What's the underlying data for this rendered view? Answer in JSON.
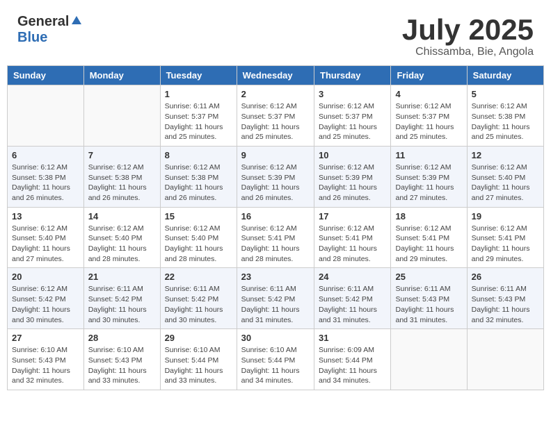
{
  "header": {
    "logo_general": "General",
    "logo_blue": "Blue",
    "title": "July 2025",
    "location": "Chissamba, Bie, Angola"
  },
  "weekdays": [
    "Sunday",
    "Monday",
    "Tuesday",
    "Wednesday",
    "Thursday",
    "Friday",
    "Saturday"
  ],
  "weeks": [
    [
      {
        "day": "",
        "empty": true
      },
      {
        "day": "",
        "empty": true
      },
      {
        "day": "1",
        "sunrise": "6:11 AM",
        "sunset": "5:37 PM",
        "daylight": "11 hours and 25 minutes."
      },
      {
        "day": "2",
        "sunrise": "6:12 AM",
        "sunset": "5:37 PM",
        "daylight": "11 hours and 25 minutes."
      },
      {
        "day": "3",
        "sunrise": "6:12 AM",
        "sunset": "5:37 PM",
        "daylight": "11 hours and 25 minutes."
      },
      {
        "day": "4",
        "sunrise": "6:12 AM",
        "sunset": "5:37 PM",
        "daylight": "11 hours and 25 minutes."
      },
      {
        "day": "5",
        "sunrise": "6:12 AM",
        "sunset": "5:38 PM",
        "daylight": "11 hours and 25 minutes."
      }
    ],
    [
      {
        "day": "6",
        "sunrise": "6:12 AM",
        "sunset": "5:38 PM",
        "daylight": "11 hours and 26 minutes."
      },
      {
        "day": "7",
        "sunrise": "6:12 AM",
        "sunset": "5:38 PM",
        "daylight": "11 hours and 26 minutes."
      },
      {
        "day": "8",
        "sunrise": "6:12 AM",
        "sunset": "5:38 PM",
        "daylight": "11 hours and 26 minutes."
      },
      {
        "day": "9",
        "sunrise": "6:12 AM",
        "sunset": "5:39 PM",
        "daylight": "11 hours and 26 minutes."
      },
      {
        "day": "10",
        "sunrise": "6:12 AM",
        "sunset": "5:39 PM",
        "daylight": "11 hours and 26 minutes."
      },
      {
        "day": "11",
        "sunrise": "6:12 AM",
        "sunset": "5:39 PM",
        "daylight": "11 hours and 27 minutes."
      },
      {
        "day": "12",
        "sunrise": "6:12 AM",
        "sunset": "5:40 PM",
        "daylight": "11 hours and 27 minutes."
      }
    ],
    [
      {
        "day": "13",
        "sunrise": "6:12 AM",
        "sunset": "5:40 PM",
        "daylight": "11 hours and 27 minutes."
      },
      {
        "day": "14",
        "sunrise": "6:12 AM",
        "sunset": "5:40 PM",
        "daylight": "11 hours and 28 minutes."
      },
      {
        "day": "15",
        "sunrise": "6:12 AM",
        "sunset": "5:40 PM",
        "daylight": "11 hours and 28 minutes."
      },
      {
        "day": "16",
        "sunrise": "6:12 AM",
        "sunset": "5:41 PM",
        "daylight": "11 hours and 28 minutes."
      },
      {
        "day": "17",
        "sunrise": "6:12 AM",
        "sunset": "5:41 PM",
        "daylight": "11 hours and 28 minutes."
      },
      {
        "day": "18",
        "sunrise": "6:12 AM",
        "sunset": "5:41 PM",
        "daylight": "11 hours and 29 minutes."
      },
      {
        "day": "19",
        "sunrise": "6:12 AM",
        "sunset": "5:41 PM",
        "daylight": "11 hours and 29 minutes."
      }
    ],
    [
      {
        "day": "20",
        "sunrise": "6:12 AM",
        "sunset": "5:42 PM",
        "daylight": "11 hours and 30 minutes."
      },
      {
        "day": "21",
        "sunrise": "6:11 AM",
        "sunset": "5:42 PM",
        "daylight": "11 hours and 30 minutes."
      },
      {
        "day": "22",
        "sunrise": "6:11 AM",
        "sunset": "5:42 PM",
        "daylight": "11 hours and 30 minutes."
      },
      {
        "day": "23",
        "sunrise": "6:11 AM",
        "sunset": "5:42 PM",
        "daylight": "11 hours and 31 minutes."
      },
      {
        "day": "24",
        "sunrise": "6:11 AM",
        "sunset": "5:42 PM",
        "daylight": "11 hours and 31 minutes."
      },
      {
        "day": "25",
        "sunrise": "6:11 AM",
        "sunset": "5:43 PM",
        "daylight": "11 hours and 31 minutes."
      },
      {
        "day": "26",
        "sunrise": "6:11 AM",
        "sunset": "5:43 PM",
        "daylight": "11 hours and 32 minutes."
      }
    ],
    [
      {
        "day": "27",
        "sunrise": "6:10 AM",
        "sunset": "5:43 PM",
        "daylight": "11 hours and 32 minutes."
      },
      {
        "day": "28",
        "sunrise": "6:10 AM",
        "sunset": "5:43 PM",
        "daylight": "11 hours and 33 minutes."
      },
      {
        "day": "29",
        "sunrise": "6:10 AM",
        "sunset": "5:44 PM",
        "daylight": "11 hours and 33 minutes."
      },
      {
        "day": "30",
        "sunrise": "6:10 AM",
        "sunset": "5:44 PM",
        "daylight": "11 hours and 34 minutes."
      },
      {
        "day": "31",
        "sunrise": "6:09 AM",
        "sunset": "5:44 PM",
        "daylight": "11 hours and 34 minutes."
      },
      {
        "day": "",
        "empty": true
      },
      {
        "day": "",
        "empty": true
      }
    ]
  ]
}
